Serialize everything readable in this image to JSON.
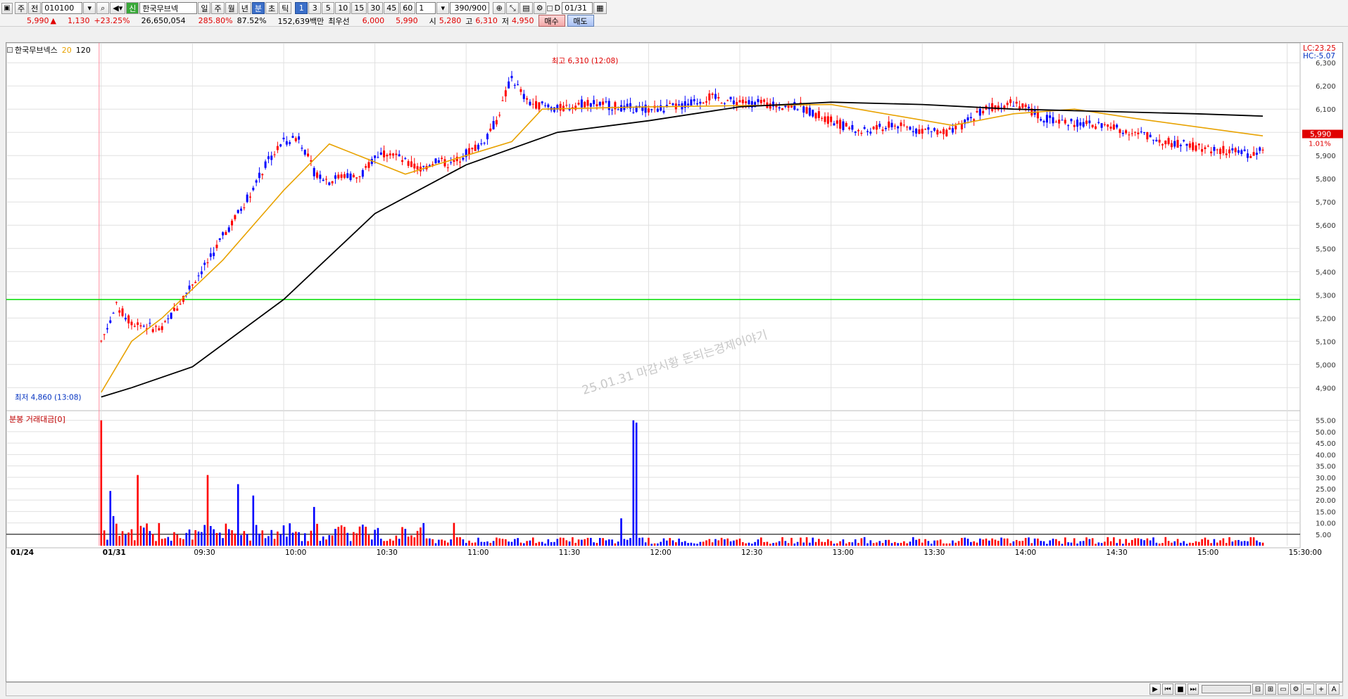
{
  "toolbar": {
    "market_select": "주",
    "view_select": "전",
    "code": "010100",
    "stock_name": "한국무브넥",
    "badge": "신",
    "periods": [
      "일",
      "주",
      "월",
      "년",
      "분",
      "초",
      "틱"
    ],
    "active_period": "분",
    "intervals": [
      "1",
      "3",
      "5",
      "10",
      "15",
      "30",
      "45",
      "60"
    ],
    "active_interval": "1",
    "multiplier": "1",
    "count": "390/900",
    "date_checkbox_label": "D",
    "date": "01/31"
  },
  "quote": {
    "price": "5,990",
    "change_sign": "▲",
    "change": "1,130",
    "change_rate": "+23.25%",
    "volume": "26,650,054",
    "volume_rate": "285.80%",
    "turnover_rate": "87.52%",
    "amount": "152,639백만",
    "best_label": "최우선",
    "best_ask": "6,000",
    "best_bid": "5,990",
    "open_label": "시",
    "open": "5,280",
    "high_label": "고",
    "high": "6,310",
    "low_label": "저",
    "low": "4,950",
    "buy_label": "매수",
    "sell_label": "매도"
  },
  "chart_header": {
    "name": "한국무브넥스",
    "ma20": "20",
    "ma120": "120"
  },
  "volume_header": "분봉 거래대금[0]",
  "annotations": {
    "high": "최고 6,310 (12:08)",
    "low": "최저 4,860 (13:08)",
    "watermark": "25.01.31 마감시황 돈되는경제이야기"
  },
  "right_labels": {
    "lc": "LC:23.25",
    "hc": "HC:-5.07",
    "current_price": "5,990",
    "current_rate": "1.01%"
  },
  "colors": {
    "up": "#ff0000",
    "down": "#0000ff",
    "ma20": "#e8a200",
    "ma120": "#000000",
    "hline": "#00dd00",
    "grid": "#e0e0e0"
  },
  "chart_data": {
    "type": "candlestick",
    "x_ticks": [
      "01/24",
      "01/31",
      "09:30",
      "10:00",
      "10:30",
      "11:00",
      "11:30",
      "12:00",
      "12:30",
      "13:00",
      "13:30",
      "14:00",
      "14:30",
      "15:00",
      "15:30:00"
    ],
    "y_ticks": [
      4900,
      5000,
      5100,
      5200,
      5300,
      5400,
      5500,
      5600,
      5700,
      5800,
      5900,
      6000,
      6100,
      6200,
      6300
    ],
    "y_tick_labels": [
      "4,900",
      "5,000",
      "5,100",
      "5,200",
      "5,300",
      "5,400",
      "5,500",
      "5,600",
      "5,700",
      "5,800",
      "5,900",
      "6,000",
      "6,100",
      "6,200",
      "6,300"
    ],
    "ylim": [
      4810,
      6340
    ],
    "reference_line": 5280,
    "vol_ticks": [
      5,
      10,
      15,
      20,
      25,
      30,
      35,
      40,
      45,
      50,
      55
    ],
    "vol_tick_labels": [
      "5.00",
      "10.00",
      "15.00",
      "20.00",
      "25.00",
      "30.00",
      "35.00",
      "40.00",
      "45.00",
      "50.00",
      "55.00"
    ],
    "vol_ylim": [
      0,
      58
    ],
    "vol_reference": 5,
    "path_minutes": [
      0,
      5,
      10,
      20,
      30,
      35,
      40,
      45,
      50,
      55,
      60,
      65,
      70,
      75,
      80,
      85,
      90,
      95,
      100,
      105,
      110,
      115,
      120,
      125,
      130,
      135,
      140,
      150,
      160,
      170,
      180,
      190,
      200,
      210,
      220,
      230,
      240,
      250,
      260,
      270,
      280,
      290,
      300,
      310,
      320,
      330,
      340,
      350,
      360,
      370,
      380,
      382
    ],
    "path_prices": [
      5100,
      5250,
      5180,
      5150,
      5350,
      5440,
      5550,
      5650,
      5760,
      5880,
      5960,
      5980,
      5830,
      5790,
      5820,
      5800,
      5900,
      5920,
      5870,
      5840,
      5880,
      5860,
      5910,
      5950,
      6050,
      6240,
      6130,
      6100,
      6130,
      6110,
      6100,
      6110,
      6150,
      6130,
      6120,
      6110,
      6050,
      6000,
      6030,
      6010,
      6000,
      6100,
      6130,
      6060,
      6040,
      6030,
      6000,
      5960,
      5940,
      5920,
      5900,
      5940
    ],
    "ma20_minutes": [
      0,
      10,
      20,
      40,
      60,
      75,
      100,
      120,
      135,
      145,
      180,
      240,
      280,
      300,
      320,
      340,
      382
    ],
    "ma20_prices": [
      4880,
      5100,
      5200,
      5450,
      5750,
      5950,
      5820,
      5900,
      5960,
      6100,
      6110,
      6120,
      6030,
      6080,
      6100,
      6060,
      5985
    ],
    "ma120_minutes": [
      0,
      10,
      30,
      60,
      90,
      120,
      150,
      180,
      210,
      240,
      270,
      300,
      330,
      360,
      382
    ],
    "ma120_prices": [
      4860,
      4900,
      4990,
      5280,
      5650,
      5860,
      6000,
      6050,
      6110,
      6130,
      6120,
      6100,
      6090,
      6080,
      6070
    ],
    "volume_spikes": [
      [
        0,
        55
      ],
      [
        12,
        31
      ],
      [
        35,
        31
      ],
      [
        45,
        27
      ],
      [
        175,
        55
      ],
      [
        176,
        54
      ],
      [
        3,
        24
      ],
      [
        4,
        13
      ],
      [
        50,
        22
      ],
      [
        70,
        17
      ],
      [
        116,
        10
      ],
      [
        171,
        12
      ]
    ]
  }
}
